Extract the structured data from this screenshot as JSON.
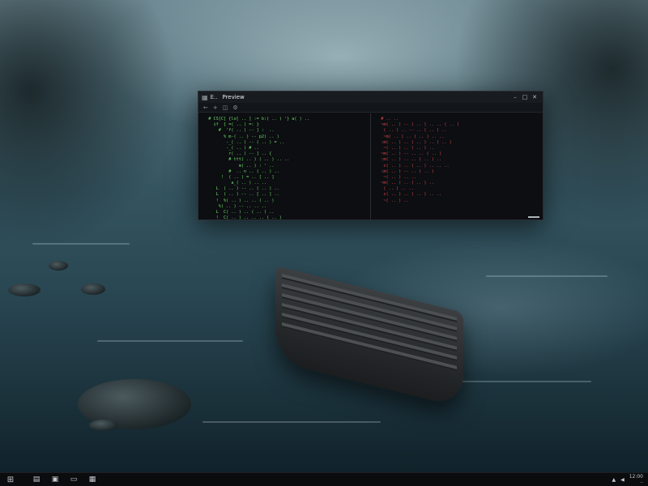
{
  "terminal": {
    "tabs": [
      {
        "label": "E.."
      },
      {
        "label": "Preview"
      }
    ],
    "window_controls": [
      "–",
      "□",
      "✕"
    ],
    "toolbar_icons": [
      "back-icon",
      "new-tab-icon",
      "split-icon",
      "settings-icon"
    ],
    "left_pane_lines": [
      "  # CS[C] {lo[ .. ] := b:( .. ) '} a( ) ..",
      "    if  { =( .. ) =: }",
      "      #  'f( .. ) -- ] :  ..",
      "        % m-( .. ) -- p2( .. )",
      "         -_( .. ) -- ( .. ) = ..",
      "         -_( .. ) # ..",
      "          r( .. ) -- ] .. {",
      "          # ttt( .. ) ( .. ) .. ..",
      "              m( .. ) : ' ..",
      "          #  .. n .. ( .. ) ..",
      "       !  ( .. ) = .. [ .. ]",
      "           a_( .. ) .. ..",
      "     L  ( .. ) -- .. ( .. ) ..",
      "     L  ( .. ) -- .. [ .. ] ..",
      "     !  %( .. ) .. .. ( .. )",
      "      %( .. ) -- .. .. ..",
      "     L  C( .. ) .. ( .. ) ..",
      "     !  C( .. ) .. .. .. ( .. )"
    ],
    "right_pane_lines": [
      "  # .. ..",
      "  ~m( .. ) -- ( .. ) .. .. ( .. )",
      "   ( .. ) .. -- .. ( .. ) ..",
      "   ~m( .. ) .. ( .. ) .. ..",
      "  :m( .. ) .. ( .. ) .. ( .. )",
      "   ~( .. ) .. ( .. ) ..",
      "  ~m( .. ) -- .. .. ( .. )",
      "  :m( .. ) .. .. ( .. ) ..",
      "   c( .. ) .. ( .. ) .. .. ..",
      "  :m( .. ) -- .. ( .. )",
      "   ~( .. ) .. ..",
      "  ~m( .. ) .. ( .. ) ..",
      "   ( .. ) .. ..",
      "   c( .. ) .. ( .. ) .. ..",
      "   ~( .. ) .."
    ]
  },
  "taskbar": {
    "start_icon": "⊞",
    "apps": [
      {
        "name": "file-explorer-icon",
        "glyph": "▤"
      },
      {
        "name": "browser-icon",
        "glyph": "▣"
      },
      {
        "name": "terminal-app-icon",
        "glyph": "▭"
      },
      {
        "name": "media-icon",
        "glyph": "▦"
      }
    ],
    "tray": {
      "network_icon": "▲",
      "volume_icon": "◀",
      "time": "12:00",
      "date": ".."
    }
  }
}
